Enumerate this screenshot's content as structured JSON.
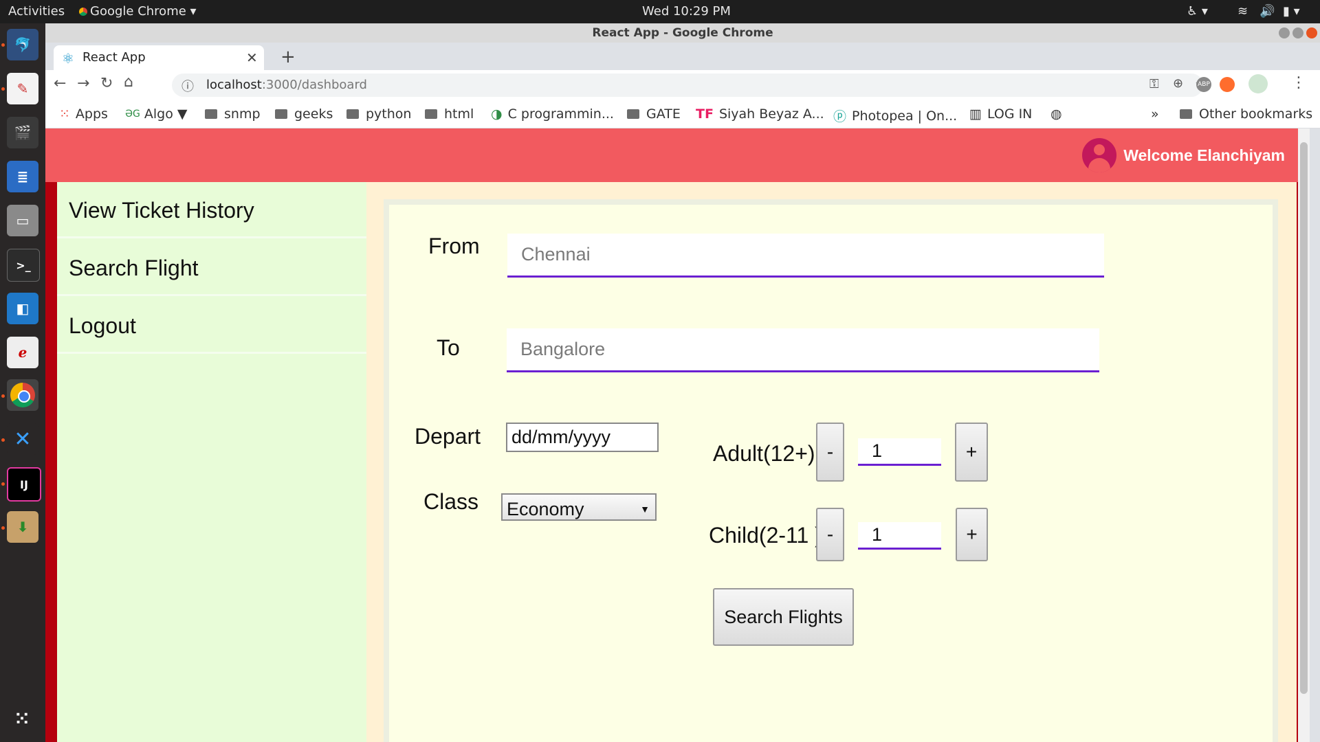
{
  "system": {
    "activities": "Activities",
    "app_menu": "Google Chrome",
    "clock": "Wed 10:29 PM"
  },
  "window": {
    "title": "React App - Google Chrome"
  },
  "browser": {
    "tab_title": "React App",
    "new_tab": "+",
    "url_host": "localhost",
    "url_path": ":3000/dashboard",
    "bookmarks": [
      "Apps",
      "Algo ▼",
      "snmp",
      "geeks",
      "python",
      "html",
      "C programmin...",
      "GATE",
      "Siyah Beyaz A...",
      "Photopea | On...",
      "LOG IN"
    ],
    "more": "»",
    "other_bookmarks": "Other bookmarks"
  },
  "header": {
    "welcome": "Welcome Elanchiyam"
  },
  "sidebar": {
    "items": [
      {
        "label": "View Ticket History"
      },
      {
        "label": "Search Flight"
      },
      {
        "label": "Logout"
      }
    ]
  },
  "form": {
    "from_label": "From",
    "from_placeholder": "Chennai",
    "to_label": "To",
    "to_placeholder": "Bangalore",
    "depart_label": "Depart",
    "depart_value": "dd/mm/yyyy",
    "class_label": "Class",
    "class_value": "Economy",
    "adult_label": "Adult(12+)",
    "adult_value": "1",
    "child_label": "Child(2-11 )",
    "child_value": "1",
    "minus": "-",
    "plus": "+",
    "search_button": "Search Flights"
  }
}
